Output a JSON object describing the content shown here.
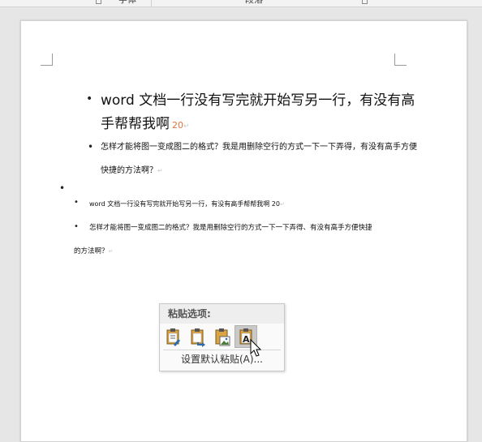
{
  "ribbon": {
    "group_font_label": "字体",
    "group_paragraph_label": "段落"
  },
  "document": {
    "para1": {
      "line1": "word 文档一行没有写完就开始写另一行，有没有高",
      "line2_text": "手帮帮我啊",
      "line2_number": "20"
    },
    "para2": {
      "line1": "怎样才能将图一变成图二的格式？我是用删除空行的方式一下一下弄得，有没有高手方便",
      "line2": "快捷的方法啊？"
    },
    "para4": {
      "line1": "word 文档一行没有写完就开始写另一行，有没有高手帮帮我啊  20"
    },
    "para5": {
      "line1": "怎样才能将图一变成图二的格式？我是用删除空行的方式一下一下弄得、有没有高手方便快捷",
      "line2": "的方法啊？"
    },
    "paragraph_mark": "↵"
  },
  "paste_options": {
    "title": "粘贴选项:",
    "buttons": [
      {
        "name": "keep-source-formatting",
        "icon": "clipboard-brush-icon"
      },
      {
        "name": "merge-formatting",
        "icon": "clipboard-arrow-icon"
      },
      {
        "name": "picture",
        "icon": "clipboard-picture-icon"
      },
      {
        "name": "keep-text-only",
        "icon": "clipboard-text-icon",
        "active": true
      }
    ],
    "set_default_label": "设置默认粘贴(A)..."
  },
  "colors": {
    "accent_orange": "#e0733a",
    "clipboard": "#d9a441"
  }
}
